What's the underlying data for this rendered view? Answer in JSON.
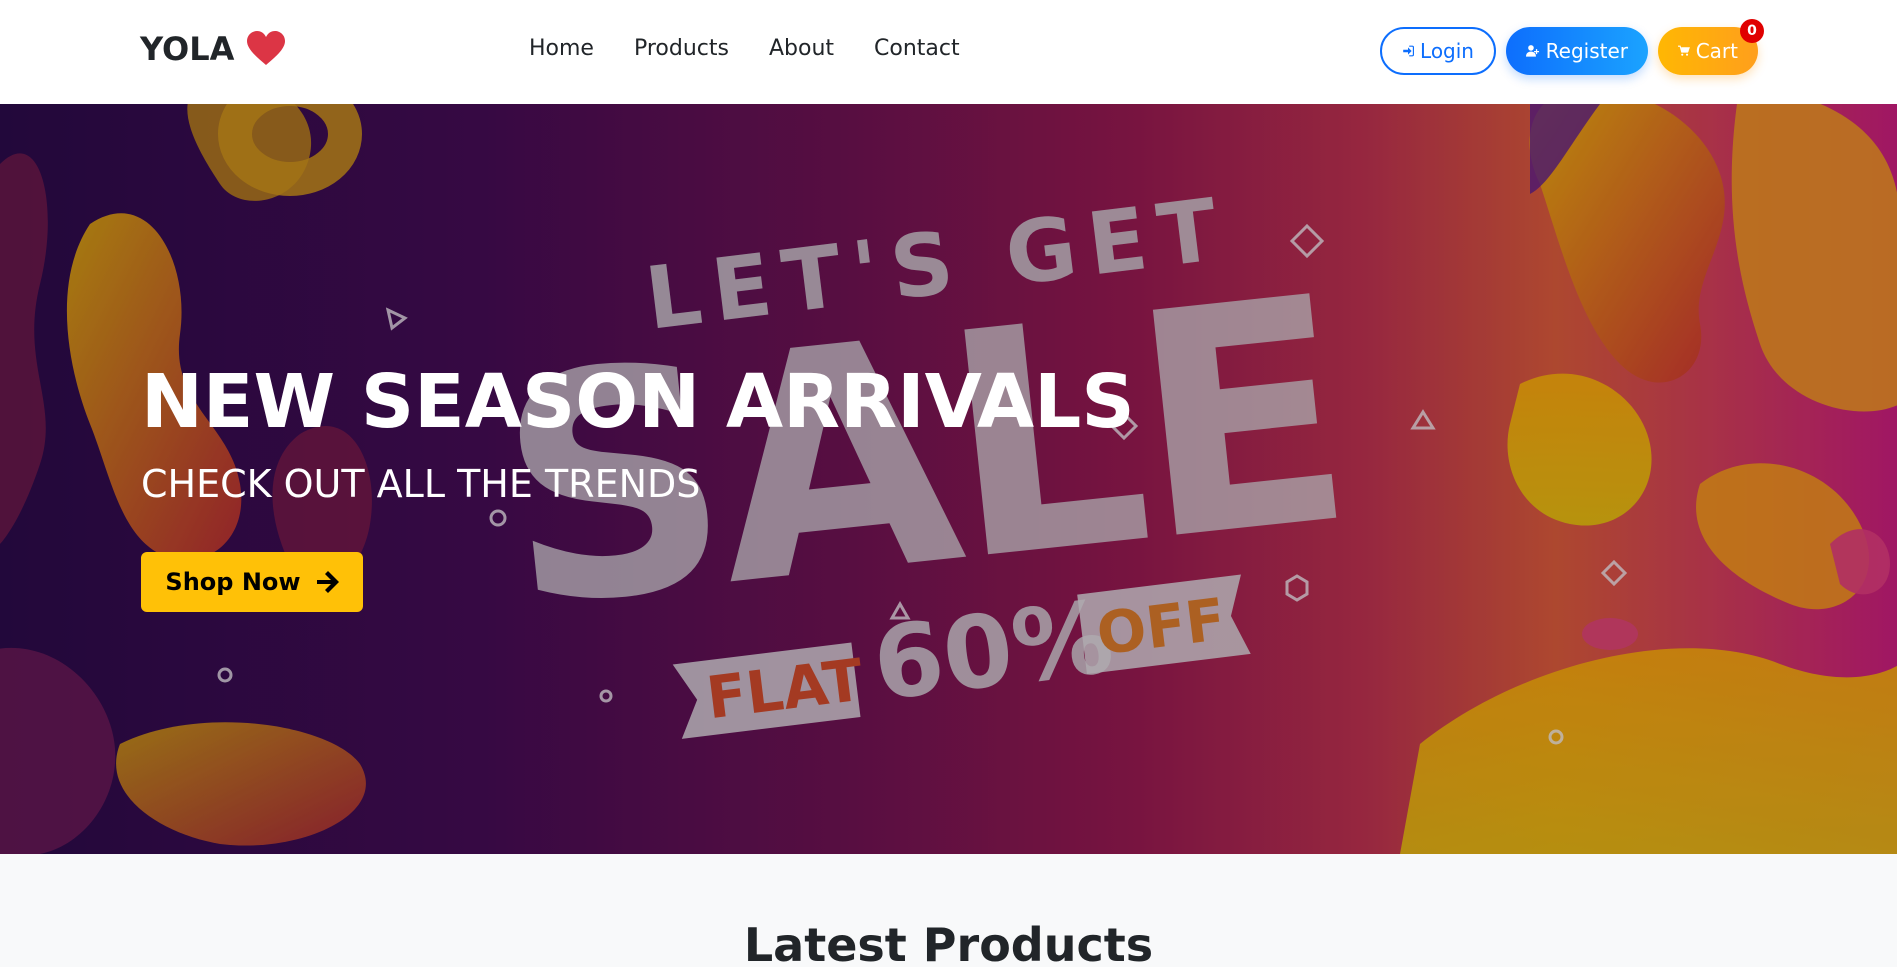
{
  "navbar": {
    "brand": "YOLA",
    "links": [
      "Home",
      "Products",
      "About",
      "Contact"
    ],
    "login_label": "Login",
    "register_label": "Register",
    "cart_label": "Cart",
    "cart_count": "0"
  },
  "hero": {
    "title": "NEW SEASON ARRIVALS",
    "subtitle": "CHECK OUT ALL THE TRENDS",
    "cta_label": "Shop Now",
    "banner_text": {
      "line1": "LET'S GET",
      "line2": "SALE",
      "flat": "FLAT",
      "percent": "60%",
      "off": "OFF"
    }
  },
  "products": {
    "heading": "Latest Products"
  },
  "colors": {
    "primary": "#0d6efd",
    "warning": "#ffc107",
    "heart": "#dc3545",
    "badge": "#e00000"
  },
  "icons": {
    "brand": "heart-icon",
    "login": "sign-in-icon",
    "register": "user-plus-icon",
    "cart": "shopping-cart-icon",
    "cta": "arrow-right-icon"
  }
}
